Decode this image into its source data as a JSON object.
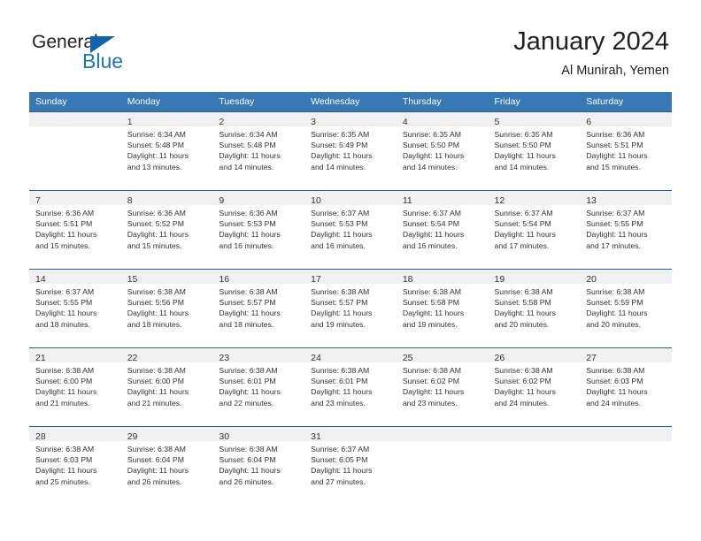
{
  "brand": {
    "name_top": "General",
    "name_bottom": "Blue",
    "triangle_color": "#1263ad",
    "text_color_top": "#231f20",
    "text_color_bottom": "#1b75bb"
  },
  "header": {
    "title": "January 2024",
    "subtitle": "Al Munirah, Yemen"
  },
  "theme": {
    "header_row_bg": "#3878b5",
    "header_row_text": "#ffffff",
    "daynum_band_bg": "#f1f1f1",
    "row_separator": "#2a6099",
    "body_text": "#333333"
  },
  "weekday_headers": [
    "Sunday",
    "Monday",
    "Tuesday",
    "Wednesday",
    "Thursday",
    "Friday",
    "Saturday"
  ],
  "weeks": [
    [
      {
        "day": "",
        "sunrise": "",
        "sunset": "",
        "daylight_line1": "",
        "daylight_line2": ""
      },
      {
        "day": "1",
        "sunrise": "Sunrise: 6:34 AM",
        "sunset": "Sunset: 5:48 PM",
        "daylight_line1": "Daylight: 11 hours",
        "daylight_line2": "and 13 minutes."
      },
      {
        "day": "2",
        "sunrise": "Sunrise: 6:34 AM",
        "sunset": "Sunset: 5:48 PM",
        "daylight_line1": "Daylight: 11 hours",
        "daylight_line2": "and 14 minutes."
      },
      {
        "day": "3",
        "sunrise": "Sunrise: 6:35 AM",
        "sunset": "Sunset: 5:49 PM",
        "daylight_line1": "Daylight: 11 hours",
        "daylight_line2": "and 14 minutes."
      },
      {
        "day": "4",
        "sunrise": "Sunrise: 6:35 AM",
        "sunset": "Sunset: 5:50 PM",
        "daylight_line1": "Daylight: 11 hours",
        "daylight_line2": "and 14 minutes."
      },
      {
        "day": "5",
        "sunrise": "Sunrise: 6:35 AM",
        "sunset": "Sunset: 5:50 PM",
        "daylight_line1": "Daylight: 11 hours",
        "daylight_line2": "and 14 minutes."
      },
      {
        "day": "6",
        "sunrise": "Sunrise: 6:36 AM",
        "sunset": "Sunset: 5:51 PM",
        "daylight_line1": "Daylight: 11 hours",
        "daylight_line2": "and 15 minutes."
      }
    ],
    [
      {
        "day": "7",
        "sunrise": "Sunrise: 6:36 AM",
        "sunset": "Sunset: 5:51 PM",
        "daylight_line1": "Daylight: 11 hours",
        "daylight_line2": "and 15 minutes."
      },
      {
        "day": "8",
        "sunrise": "Sunrise: 6:36 AM",
        "sunset": "Sunset: 5:52 PM",
        "daylight_line1": "Daylight: 11 hours",
        "daylight_line2": "and 15 minutes."
      },
      {
        "day": "9",
        "sunrise": "Sunrise: 6:36 AM",
        "sunset": "Sunset: 5:53 PM",
        "daylight_line1": "Daylight: 11 hours",
        "daylight_line2": "and 16 minutes."
      },
      {
        "day": "10",
        "sunrise": "Sunrise: 6:37 AM",
        "sunset": "Sunset: 5:53 PM",
        "daylight_line1": "Daylight: 11 hours",
        "daylight_line2": "and 16 minutes."
      },
      {
        "day": "11",
        "sunrise": "Sunrise: 6:37 AM",
        "sunset": "Sunset: 5:54 PM",
        "daylight_line1": "Daylight: 11 hours",
        "daylight_line2": "and 16 minutes."
      },
      {
        "day": "12",
        "sunrise": "Sunrise: 6:37 AM",
        "sunset": "Sunset: 5:54 PM",
        "daylight_line1": "Daylight: 11 hours",
        "daylight_line2": "and 17 minutes."
      },
      {
        "day": "13",
        "sunrise": "Sunrise: 6:37 AM",
        "sunset": "Sunset: 5:55 PM",
        "daylight_line1": "Daylight: 11 hours",
        "daylight_line2": "and 17 minutes."
      }
    ],
    [
      {
        "day": "14",
        "sunrise": "Sunrise: 6:37 AM",
        "sunset": "Sunset: 5:55 PM",
        "daylight_line1": "Daylight: 11 hours",
        "daylight_line2": "and 18 minutes."
      },
      {
        "day": "15",
        "sunrise": "Sunrise: 6:38 AM",
        "sunset": "Sunset: 5:56 PM",
        "daylight_line1": "Daylight: 11 hours",
        "daylight_line2": "and 18 minutes."
      },
      {
        "day": "16",
        "sunrise": "Sunrise: 6:38 AM",
        "sunset": "Sunset: 5:57 PM",
        "daylight_line1": "Daylight: 11 hours",
        "daylight_line2": "and 18 minutes."
      },
      {
        "day": "17",
        "sunrise": "Sunrise: 6:38 AM",
        "sunset": "Sunset: 5:57 PM",
        "daylight_line1": "Daylight: 11 hours",
        "daylight_line2": "and 19 minutes."
      },
      {
        "day": "18",
        "sunrise": "Sunrise: 6:38 AM",
        "sunset": "Sunset: 5:58 PM",
        "daylight_line1": "Daylight: 11 hours",
        "daylight_line2": "and 19 minutes."
      },
      {
        "day": "19",
        "sunrise": "Sunrise: 6:38 AM",
        "sunset": "Sunset: 5:58 PM",
        "daylight_line1": "Daylight: 11 hours",
        "daylight_line2": "and 20 minutes."
      },
      {
        "day": "20",
        "sunrise": "Sunrise: 6:38 AM",
        "sunset": "Sunset: 5:59 PM",
        "daylight_line1": "Daylight: 11 hours",
        "daylight_line2": "and 20 minutes."
      }
    ],
    [
      {
        "day": "21",
        "sunrise": "Sunrise: 6:38 AM",
        "sunset": "Sunset: 6:00 PM",
        "daylight_line1": "Daylight: 11 hours",
        "daylight_line2": "and 21 minutes."
      },
      {
        "day": "22",
        "sunrise": "Sunrise: 6:38 AM",
        "sunset": "Sunset: 6:00 PM",
        "daylight_line1": "Daylight: 11 hours",
        "daylight_line2": "and 21 minutes."
      },
      {
        "day": "23",
        "sunrise": "Sunrise: 6:38 AM",
        "sunset": "Sunset: 6:01 PM",
        "daylight_line1": "Daylight: 11 hours",
        "daylight_line2": "and 22 minutes."
      },
      {
        "day": "24",
        "sunrise": "Sunrise: 6:38 AM",
        "sunset": "Sunset: 6:01 PM",
        "daylight_line1": "Daylight: 11 hours",
        "daylight_line2": "and 23 minutes."
      },
      {
        "day": "25",
        "sunrise": "Sunrise: 6:38 AM",
        "sunset": "Sunset: 6:02 PM",
        "daylight_line1": "Daylight: 11 hours",
        "daylight_line2": "and 23 minutes."
      },
      {
        "day": "26",
        "sunrise": "Sunrise: 6:38 AM",
        "sunset": "Sunset: 6:02 PM",
        "daylight_line1": "Daylight: 11 hours",
        "daylight_line2": "and 24 minutes."
      },
      {
        "day": "27",
        "sunrise": "Sunrise: 6:38 AM",
        "sunset": "Sunset: 6:03 PM",
        "daylight_line1": "Daylight: 11 hours",
        "daylight_line2": "and 24 minutes."
      }
    ],
    [
      {
        "day": "28",
        "sunrise": "Sunrise: 6:38 AM",
        "sunset": "Sunset: 6:03 PM",
        "daylight_line1": "Daylight: 11 hours",
        "daylight_line2": "and 25 minutes."
      },
      {
        "day": "29",
        "sunrise": "Sunrise: 6:38 AM",
        "sunset": "Sunset: 6:04 PM",
        "daylight_line1": "Daylight: 11 hours",
        "daylight_line2": "and 26 minutes."
      },
      {
        "day": "30",
        "sunrise": "Sunrise: 6:38 AM",
        "sunset": "Sunset: 6:04 PM",
        "daylight_line1": "Daylight: 11 hours",
        "daylight_line2": "and 26 minutes."
      },
      {
        "day": "31",
        "sunrise": "Sunrise: 6:37 AM",
        "sunset": "Sunset: 6:05 PM",
        "daylight_line1": "Daylight: 11 hours",
        "daylight_line2": "and 27 minutes."
      },
      {
        "day": "",
        "sunrise": "",
        "sunset": "",
        "daylight_line1": "",
        "daylight_line2": ""
      },
      {
        "day": "",
        "sunrise": "",
        "sunset": "",
        "daylight_line1": "",
        "daylight_line2": ""
      },
      {
        "day": "",
        "sunrise": "",
        "sunset": "",
        "daylight_line1": "",
        "daylight_line2": ""
      }
    ]
  ]
}
